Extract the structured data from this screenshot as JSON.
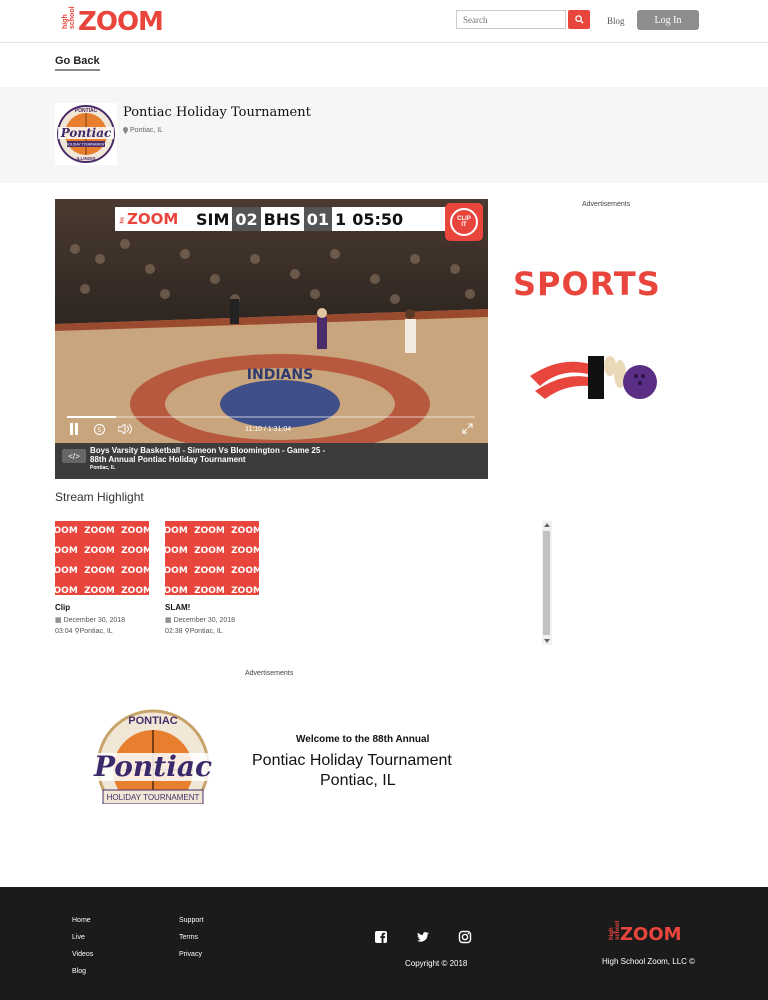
{
  "header": {
    "logo_small_line1": "high",
    "logo_small_line2": "school",
    "logo_text": "ZOOM",
    "search_placeholder": "Search",
    "blog": "Blog",
    "login": "Log In"
  },
  "go_back": "Go Back",
  "tournament": {
    "title": "Pontiac Holiday Tournament",
    "location": "Pontiac, IL",
    "logo_top": "PONTIAC",
    "logo_script": "Pontiac",
    "logo_sub": "HOLIDAY TOURNAMENT",
    "logo_bottom": "ILLINOIS"
  },
  "video": {
    "scoreboard": {
      "logo": "ZOOM",
      "team1": "SIM",
      "score1": "02",
      "team2": "BHS",
      "score2": "01",
      "period": "1",
      "clock": "05:50"
    },
    "clip_label_1": "CLIP",
    "clip_label_2": "IT",
    "time": "11:10 / 1:31:04",
    "progress": 0.12,
    "court_text": "INDIANS",
    "embed_icon": "</>",
    "caption_title": "Boys Varsity Basketball - Simeon Vs Bloomington - Game 25 - 88th Annual Pontiac Holiday Tournament",
    "caption_location": "Pontiac, IL"
  },
  "ads": {
    "label": "Advertisements",
    "sports_text": "SPORTS"
  },
  "highlights": {
    "title": "Stream Highlight",
    "thumb_text": "ZOOM",
    "items": [
      {
        "name": "Clip",
        "date": "December 30, 2018",
        "duration": "03:04",
        "location": "Pontiac, IL"
      },
      {
        "name": "SLAM!",
        "date": "December 30, 2018",
        "duration": "02:38",
        "location": "Pontiac, IL"
      }
    ]
  },
  "bottom_ad": {
    "welcome": "Welcome to the 88th Annual",
    "title": "Pontiac Holiday Tournament",
    "location": "Pontiac, IL",
    "logo_top": "PONTIAC",
    "logo_script": "Pontiac",
    "logo_sub": "HOLIDAY TOURNAMENT"
  },
  "footer": {
    "col1": [
      "Home",
      "Live",
      "Videos",
      "Blog"
    ],
    "col2": [
      "Support",
      "Terms",
      "Privacy"
    ],
    "copyright": "Copyright © 2018",
    "company": "High School Zoom, LLC ©",
    "logo_small_line1": "high",
    "logo_small_line2": "school",
    "logo_text": "ZOOM",
    "social": [
      "facebook-icon",
      "twitter-icon",
      "instagram-icon"
    ]
  },
  "colors": {
    "brand_red": "#e8463d",
    "footer_bg": "#1b1b1b",
    "banner_bg": "#f6f6f6"
  }
}
